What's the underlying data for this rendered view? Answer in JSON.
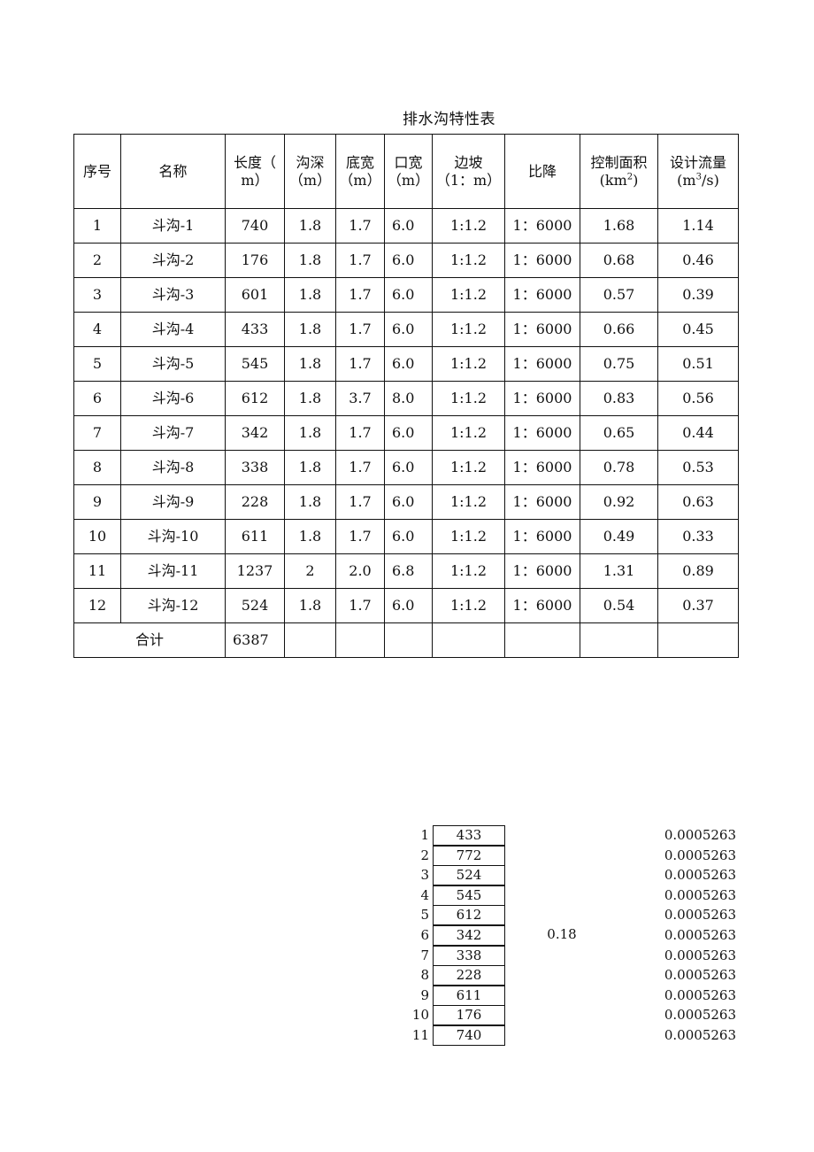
{
  "document": {
    "title": "排水沟特性表"
  },
  "table": {
    "headers": {
      "seq": "序号",
      "name": "名称",
      "length_l1": "长度（",
      "length_l2": "m）",
      "depth_l1": "沟深",
      "depth_l2": "（m）",
      "bottom_l1": "底宽",
      "bottom_l2": "（m）",
      "top_l1": "口宽",
      "top_l2": "（m）",
      "slope_l1": "边坡",
      "slope_l2": "（1：m）",
      "gradient": "比降",
      "area_l1": "控制面积",
      "area_l2_pre": "(km",
      "area_l2_sup": "2",
      "area_l2_post": ")",
      "flow_l1": "设计流量",
      "flow_l2_pre": "(m",
      "flow_l2_sup": "3",
      "flow_l2_post": "/s)"
    },
    "rows": [
      {
        "seq": "1",
        "name": "斗沟-1",
        "length": "740",
        "depth": "1.8",
        "bottom": "1.7",
        "top": "6.0",
        "slope": "1:1.2",
        "gradient": "1：6000",
        "area": "1.68",
        "flow": "1.14"
      },
      {
        "seq": "2",
        "name": "斗沟-2",
        "length": "176",
        "depth": "1.8",
        "bottom": "1.7",
        "top": "6.0",
        "slope": "1:1.2",
        "gradient": "1：6000",
        "area": "0.68",
        "flow": "0.46"
      },
      {
        "seq": "3",
        "name": "斗沟-3",
        "length": "601",
        "depth": "1.8",
        "bottom": "1.7",
        "top": "6.0",
        "slope": "1:1.2",
        "gradient": "1：6000",
        "area": "0.57",
        "flow": "0.39"
      },
      {
        "seq": "4",
        "name": "斗沟-4",
        "length": "433",
        "depth": "1.8",
        "bottom": "1.7",
        "top": "6.0",
        "slope": "1:1.2",
        "gradient": "1：6000",
        "area": "0.66",
        "flow": "0.45"
      },
      {
        "seq": "5",
        "name": "斗沟-5",
        "length": "545",
        "depth": "1.8",
        "bottom": "1.7",
        "top": "6.0",
        "slope": "1:1.2",
        "gradient": "1：6000",
        "area": "0.75",
        "flow": "0.51"
      },
      {
        "seq": "6",
        "name": "斗沟-6",
        "length": "612",
        "depth": "1.8",
        "bottom": "3.7",
        "top": "8.0",
        "slope": "1:1.2",
        "gradient": "1：6000",
        "area": "0.83",
        "flow": "0.56"
      },
      {
        "seq": "7",
        "name": "斗沟-7",
        "length": "342",
        "depth": "1.8",
        "bottom": "1.7",
        "top": "6.0",
        "slope": "1:1.2",
        "gradient": "1：6000",
        "area": "0.65",
        "flow": "0.44"
      },
      {
        "seq": "8",
        "name": "斗沟-8",
        "length": "338",
        "depth": "1.8",
        "bottom": "1.7",
        "top": "6.0",
        "slope": "1:1.2",
        "gradient": "1：6000",
        "area": "0.78",
        "flow": "0.53"
      },
      {
        "seq": "9",
        "name": "斗沟-9",
        "length": "228",
        "depth": "1.8",
        "bottom": "1.7",
        "top": "6.0",
        "slope": "1:1.2",
        "gradient": "1：6000",
        "area": "0.92",
        "flow": "0.63"
      },
      {
        "seq": "10",
        "name": "斗沟-10",
        "length": "611",
        "depth": "1.8",
        "bottom": "1.7",
        "top": "6.0",
        "slope": "1:1.2",
        "gradient": "1：6000",
        "area": "0.49",
        "flow": "0.33"
      },
      {
        "seq": "11",
        "name": "斗沟-11",
        "length": "1237",
        "depth": "2",
        "bottom": "2.0",
        "top": "6.8",
        "slope": "1:1.2",
        "gradient": "1：6000",
        "area": "1.31",
        "flow": "0.89"
      },
      {
        "seq": "12",
        "name": "斗沟-12",
        "length": "524",
        "depth": "1.8",
        "bottom": "1.7",
        "top": "6.0",
        "slope": "1:1.2",
        "gradient": "1：6000",
        "area": "0.54",
        "flow": "0.37"
      }
    ],
    "total": {
      "label": "合计",
      "length": "6387"
    }
  },
  "calc": {
    "middle_value": "0.18",
    "items": [
      {
        "idx": "1",
        "value": "433",
        "rate": "0.0005263"
      },
      {
        "idx": "2",
        "value": "772",
        "rate": "0.0005263"
      },
      {
        "idx": "3",
        "value": "524",
        "rate": "0.0005263"
      },
      {
        "idx": "4",
        "value": "545",
        "rate": "0.0005263"
      },
      {
        "idx": "5",
        "value": "612",
        "rate": "0.0005263"
      },
      {
        "idx": "6",
        "value": "342",
        "rate": "0.0005263"
      },
      {
        "idx": "7",
        "value": "338",
        "rate": "0.0005263"
      },
      {
        "idx": "8",
        "value": "228",
        "rate": "0.0005263"
      },
      {
        "idx": "9",
        "value": "611",
        "rate": "0.0005263"
      },
      {
        "idx": "10",
        "value": "176",
        "rate": "0.0005263"
      },
      {
        "idx": "11",
        "value": "740",
        "rate": "0.0005263"
      }
    ]
  }
}
